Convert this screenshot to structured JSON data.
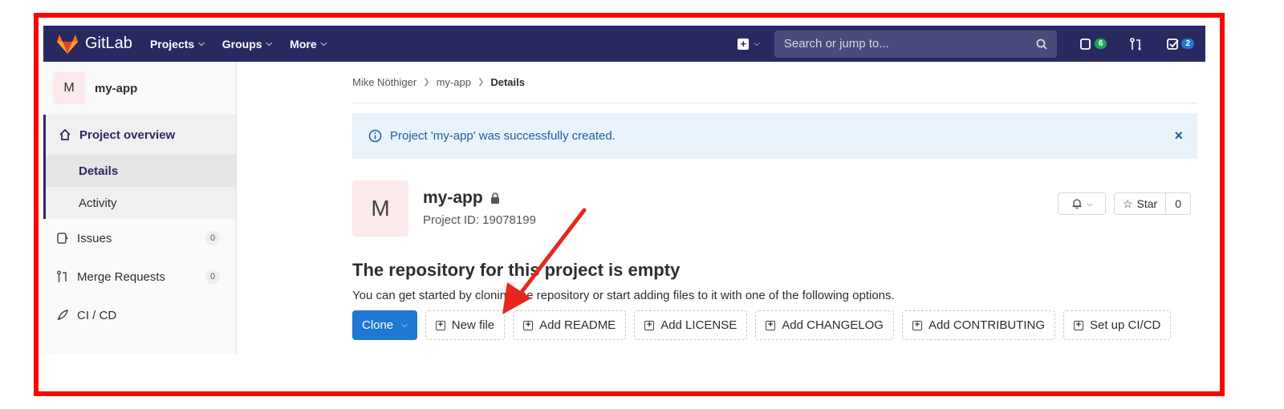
{
  "navbar": {
    "brand": "GitLab",
    "links": [
      "Projects",
      "Groups",
      "More"
    ],
    "search_placeholder": "Search or jump to...",
    "issues_badge": "6",
    "todos_badge": "2",
    "issues_badge_color": "#1aaa55",
    "todos_badge_color": "#1f78d1"
  },
  "sidebar": {
    "avatar_letter": "M",
    "project_name": "my-app",
    "overview_label": "Project overview",
    "sub_items": [
      "Details",
      "Activity"
    ],
    "issues_label": "Issues",
    "issues_count": "0",
    "mr_label": "Merge Requests",
    "mr_count": "0",
    "cicd_label": "CI / CD"
  },
  "breadcrumb": [
    "Mike Nöthiger",
    "my-app",
    "Details"
  ],
  "flash": {
    "message": "Project 'my-app' was successfully created.",
    "close": "×"
  },
  "project": {
    "avatar_letter": "M",
    "name": "my-app",
    "id_text": "Project ID: 19078199",
    "star_label": "Star",
    "star_count": "0"
  },
  "empty_repo": {
    "title": "The repository for this project is empty",
    "description": "You can get started by cloning the repository or start adding files to it with one of the following options.",
    "clone_label": "Clone",
    "buttons": [
      "New file",
      "Add README",
      "Add LICENSE",
      "Add CHANGELOG",
      "Add CONTRIBUTING",
      "Set up CI/CD"
    ]
  },
  "colors": {
    "frame": "#ff0000",
    "navbar": "#292961",
    "primary": "#1f78d1",
    "arrow": "#e8261f"
  }
}
